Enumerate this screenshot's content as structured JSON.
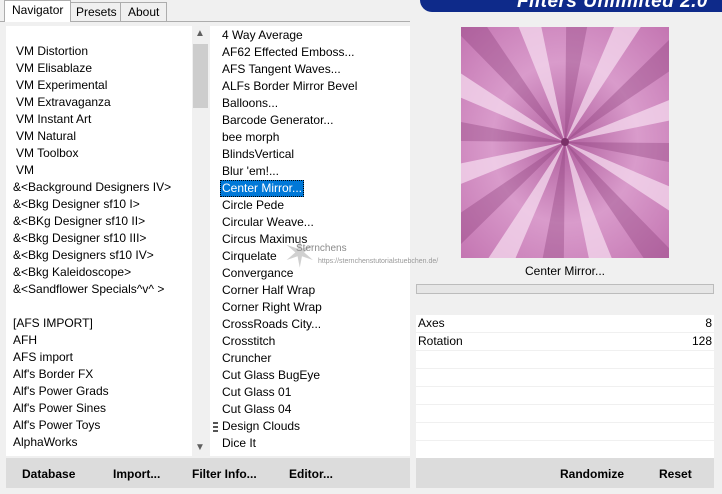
{
  "tabs": [
    {
      "label": "Navigator",
      "active": true
    },
    {
      "label": "Presets",
      "active": false
    },
    {
      "label": "About",
      "active": false
    }
  ],
  "banner": {
    "title": "Filters Unlimited 2.0",
    "color": "#0e2a8a"
  },
  "categories": [
    "VM Distortion",
    "VM Elisablaze",
    "VM Experimental",
    "VM Extravaganza",
    "VM Instant Art",
    "VM Natural",
    "VM Toolbox",
    "VM",
    "&<Background Designers IV>",
    "&<Bkg Designer sf10 I>",
    "&<BKg Designer sf10 II>",
    "&<Bkg Designer sf10 III>",
    "&<Bkg Designers sf10 IV>",
    "&<Bkg Kaleidoscope>",
    "&<Sandflower Specials^v^ >",
    "",
    "[AFS IMPORT]",
    "AFH",
    "AFS import",
    "Alf's Border FX",
    "Alf's Power Grads",
    "Alf's Power Sines",
    "Alf's Power Toys",
    "AlphaWorks"
  ],
  "filters": [
    "4 Way Average",
    "AF62 Effected Emboss...",
    "AFS Tangent Waves...",
    "ALFs Border Mirror Bevel",
    "Balloons...",
    "Barcode Generator...",
    "bee morph",
    "BlindsVertical",
    "Blur 'em!...",
    "Center Mirror...",
    "Circle Pede",
    "Circular Weave...",
    "Circus Maximus",
    "Cirquelate",
    "Convergance",
    "Corner Half Wrap",
    "Corner Right Wrap",
    "CrossRoads City...",
    "Crosstitch",
    "Cruncher",
    "Cut Glass  BugEye",
    "Cut Glass 01",
    "Cut Glass 04",
    "Design Clouds",
    "Dice It"
  ],
  "selected_filter_index": 9,
  "watermark": {
    "name": "Sternchens",
    "url": "https://sternchenstutorialstuebchen.de/"
  },
  "preview_filter_name": "Center Mirror...",
  "params": [
    {
      "label": "Axes",
      "value": "8"
    },
    {
      "label": "Rotation",
      "value": "128"
    }
  ],
  "buttons": {
    "database": "Database",
    "import": "Import...",
    "filter_info": "Filter Info...",
    "editor": "Editor...",
    "randomize": "Randomize",
    "reset": "Reset"
  },
  "colors": {
    "selection": "#0078d7",
    "preview_base": "#c77fb4",
    "preview_light": "#f4d9ee",
    "preview_dark": "#8a3c78"
  }
}
